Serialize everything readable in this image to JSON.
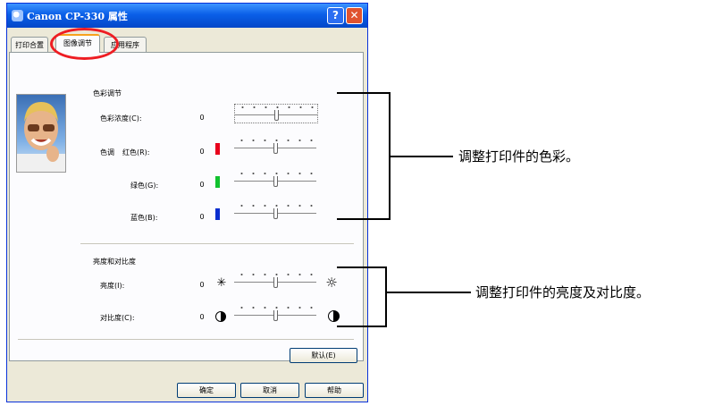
{
  "window": {
    "title": "Canon CP-330 属性",
    "help_label": "?",
    "close_label": "✕"
  },
  "tabs": [
    {
      "label": "打印合置",
      "active": false
    },
    {
      "label": "图像调节",
      "active": true
    },
    {
      "label": "应用程序",
      "active": false
    }
  ],
  "color_group": {
    "title": "色彩调节",
    "saturation": {
      "label": "色彩浓度(C):",
      "value": "0",
      "level": 0.5
    },
    "hue_label": "色调",
    "red": {
      "label": "红色(R):",
      "value": "0",
      "level": 0.5,
      "color": "#e8001c"
    },
    "green": {
      "label": "绿色(G):",
      "value": "0",
      "level": 0.5,
      "color": "#12c22f"
    },
    "blue": {
      "label": "蓝色(B):",
      "value": "0",
      "level": 0.5,
      "color": "#0b2ecf"
    }
  },
  "bc_group": {
    "title": "亮度和对比度",
    "brightness": {
      "label": "亮度(I):",
      "value": "0",
      "level": 0.5
    },
    "contrast": {
      "label": "对比度(C):",
      "value": "0",
      "level": 0.5
    }
  },
  "buttons": {
    "default": "默认(E)",
    "ok": "确定",
    "cancel": "取消",
    "help": "帮助"
  },
  "annotations": {
    "color": "调整打印件的色彩。",
    "brightness": "调整打印件的亮度及对比度。"
  },
  "icons": {
    "brightness_low": "sun-small-icon",
    "brightness_high": "sun-large-icon",
    "contrast_low": "contrast-low-icon",
    "contrast_high": "contrast-high-icon"
  },
  "highlight_color": "#ee1d23"
}
